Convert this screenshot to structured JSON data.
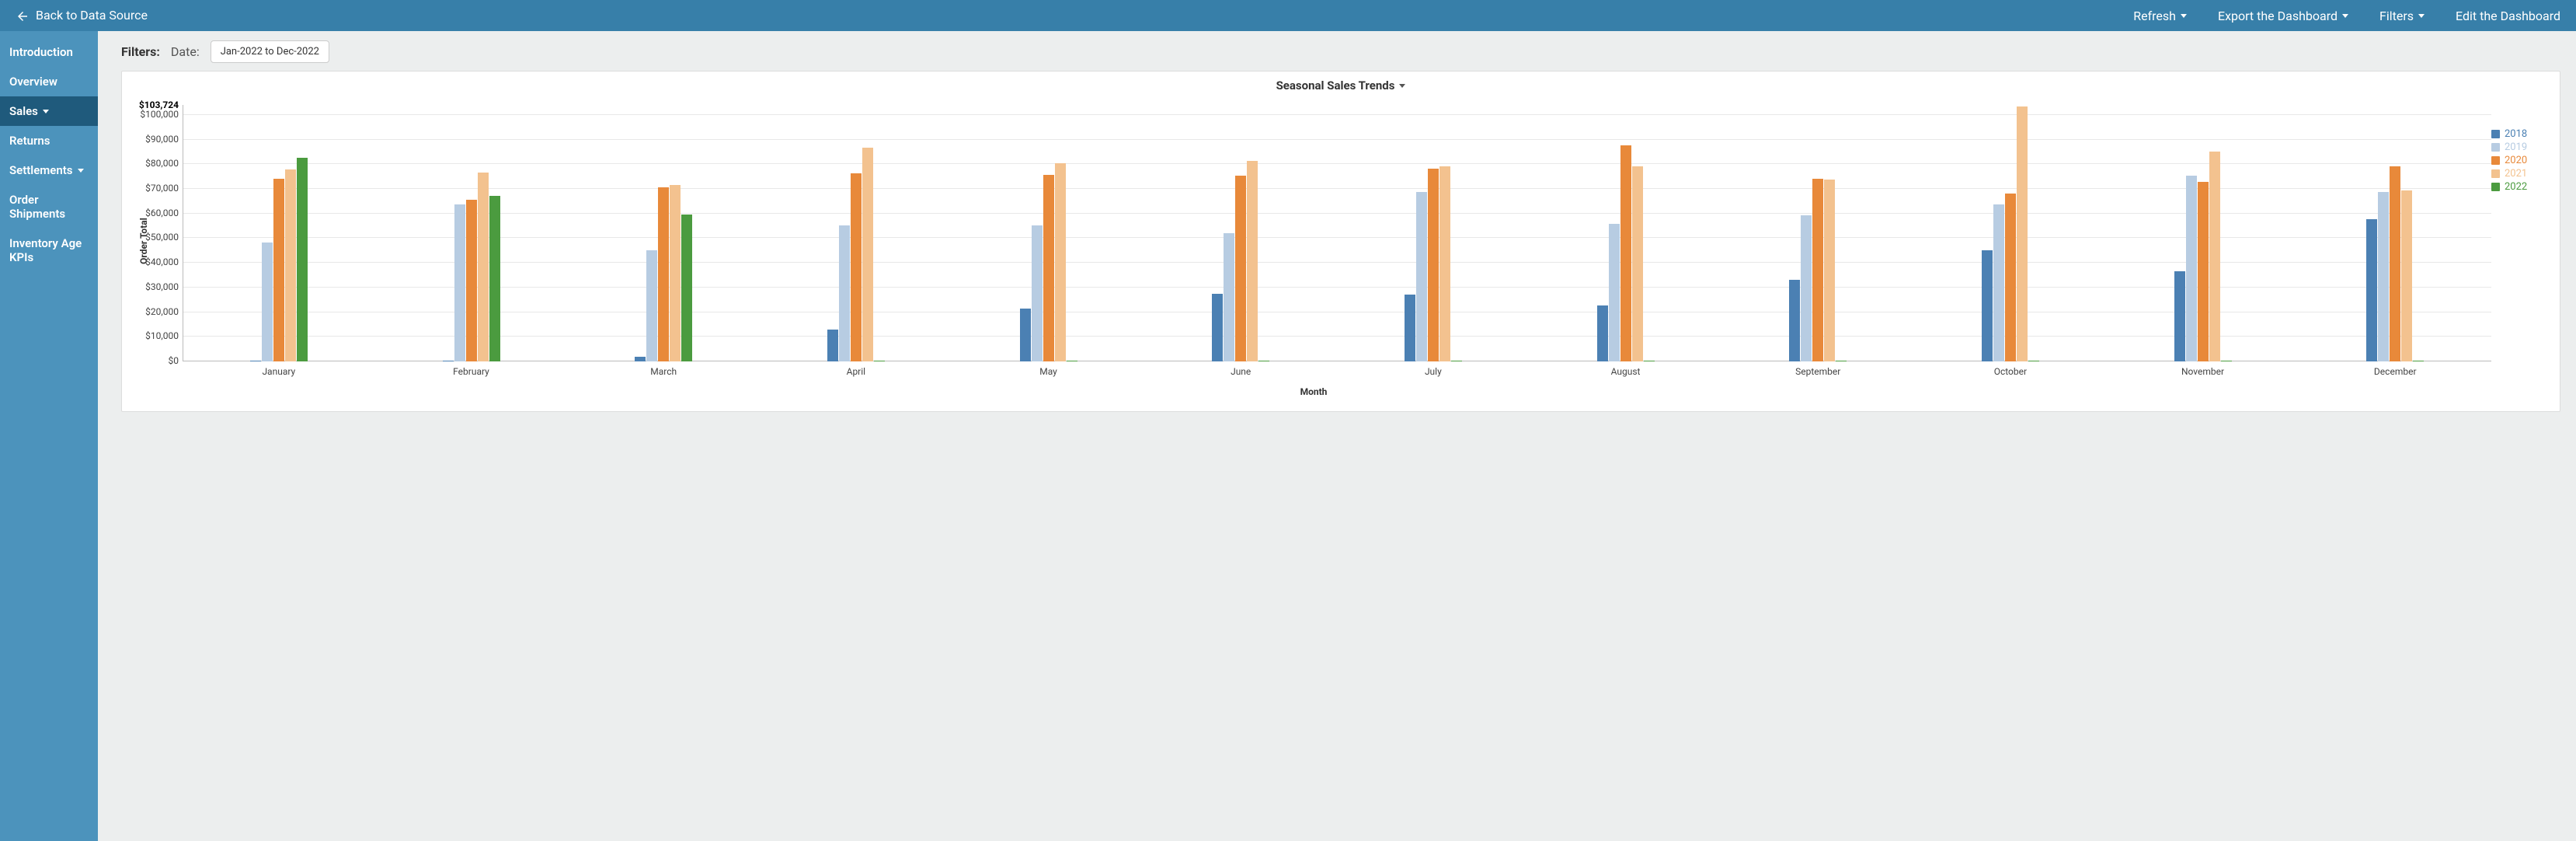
{
  "topbar": {
    "back_label": "Back to Data Source",
    "refresh": "Refresh",
    "export": "Export the Dashboard",
    "filters": "Filters",
    "edit": "Edit the Dashboard"
  },
  "sidebar": {
    "items": [
      {
        "label": "Introduction",
        "active": false,
        "dropdown": false
      },
      {
        "label": "Overview",
        "active": false,
        "dropdown": false
      },
      {
        "label": "Sales",
        "active": true,
        "dropdown": true
      },
      {
        "label": "Returns",
        "active": false,
        "dropdown": false
      },
      {
        "label": "Settlements",
        "active": false,
        "dropdown": true
      },
      {
        "label": "Order Shipments",
        "active": false,
        "dropdown": false
      },
      {
        "label": "Inventory Age KPIs",
        "active": false,
        "dropdown": false
      }
    ]
  },
  "filters": {
    "section_label": "Filters:",
    "date_label": "Date:",
    "date_value": "Jan-2022 to Dec-2022"
  },
  "chart": {
    "title": "Seasonal Sales Trends",
    "ylabel": "Order Total",
    "xlabel": "Month",
    "ymax_label": "$103,724",
    "y_ticks": [
      "$0",
      "$10,000",
      "$20,000",
      "$30,000",
      "$40,000",
      "$50,000",
      "$60,000",
      "$70,000",
      "$80,000",
      "$90,000",
      "$100,000"
    ]
  },
  "chart_data": {
    "type": "bar",
    "title": "Seasonal Sales Trends",
    "xlabel": "Month",
    "ylabel": "Order Total",
    "ylim": [
      0,
      103724
    ],
    "categories": [
      "January",
      "February",
      "March",
      "April",
      "May",
      "June",
      "July",
      "August",
      "September",
      "October",
      "November",
      "December"
    ],
    "series": [
      {
        "name": "2018",
        "color": "#4b80b3",
        "values": [
          200,
          200,
          1800,
          13000,
          21500,
          27500,
          27000,
          22500,
          33000,
          45000,
          36500,
          57500
        ]
      },
      {
        "name": "2019",
        "color": "#b7cce2",
        "values": [
          48000,
          63500,
          45000,
          55000,
          55000,
          52000,
          68500,
          55500,
          59000,
          63500,
          75000,
          68500
        ]
      },
      {
        "name": "2020",
        "color": "#e8893a",
        "values": [
          74000,
          65500,
          70500,
          76000,
          75500,
          75000,
          78000,
          87500,
          74000,
          68000,
          72500,
          79000
        ]
      },
      {
        "name": "2021",
        "color": "#f3c28f",
        "values": [
          77500,
          76500,
          71500,
          86500,
          80000,
          81000,
          79000,
          79000,
          73500,
          103000,
          85000,
          69000
        ]
      },
      {
        "name": "2022",
        "color": "#4b9b3f",
        "values": [
          82500,
          67000,
          59500,
          300,
          300,
          300,
          300,
          300,
          300,
          300,
          300,
          300
        ]
      }
    ],
    "legend_position": "right",
    "grid": true
  }
}
